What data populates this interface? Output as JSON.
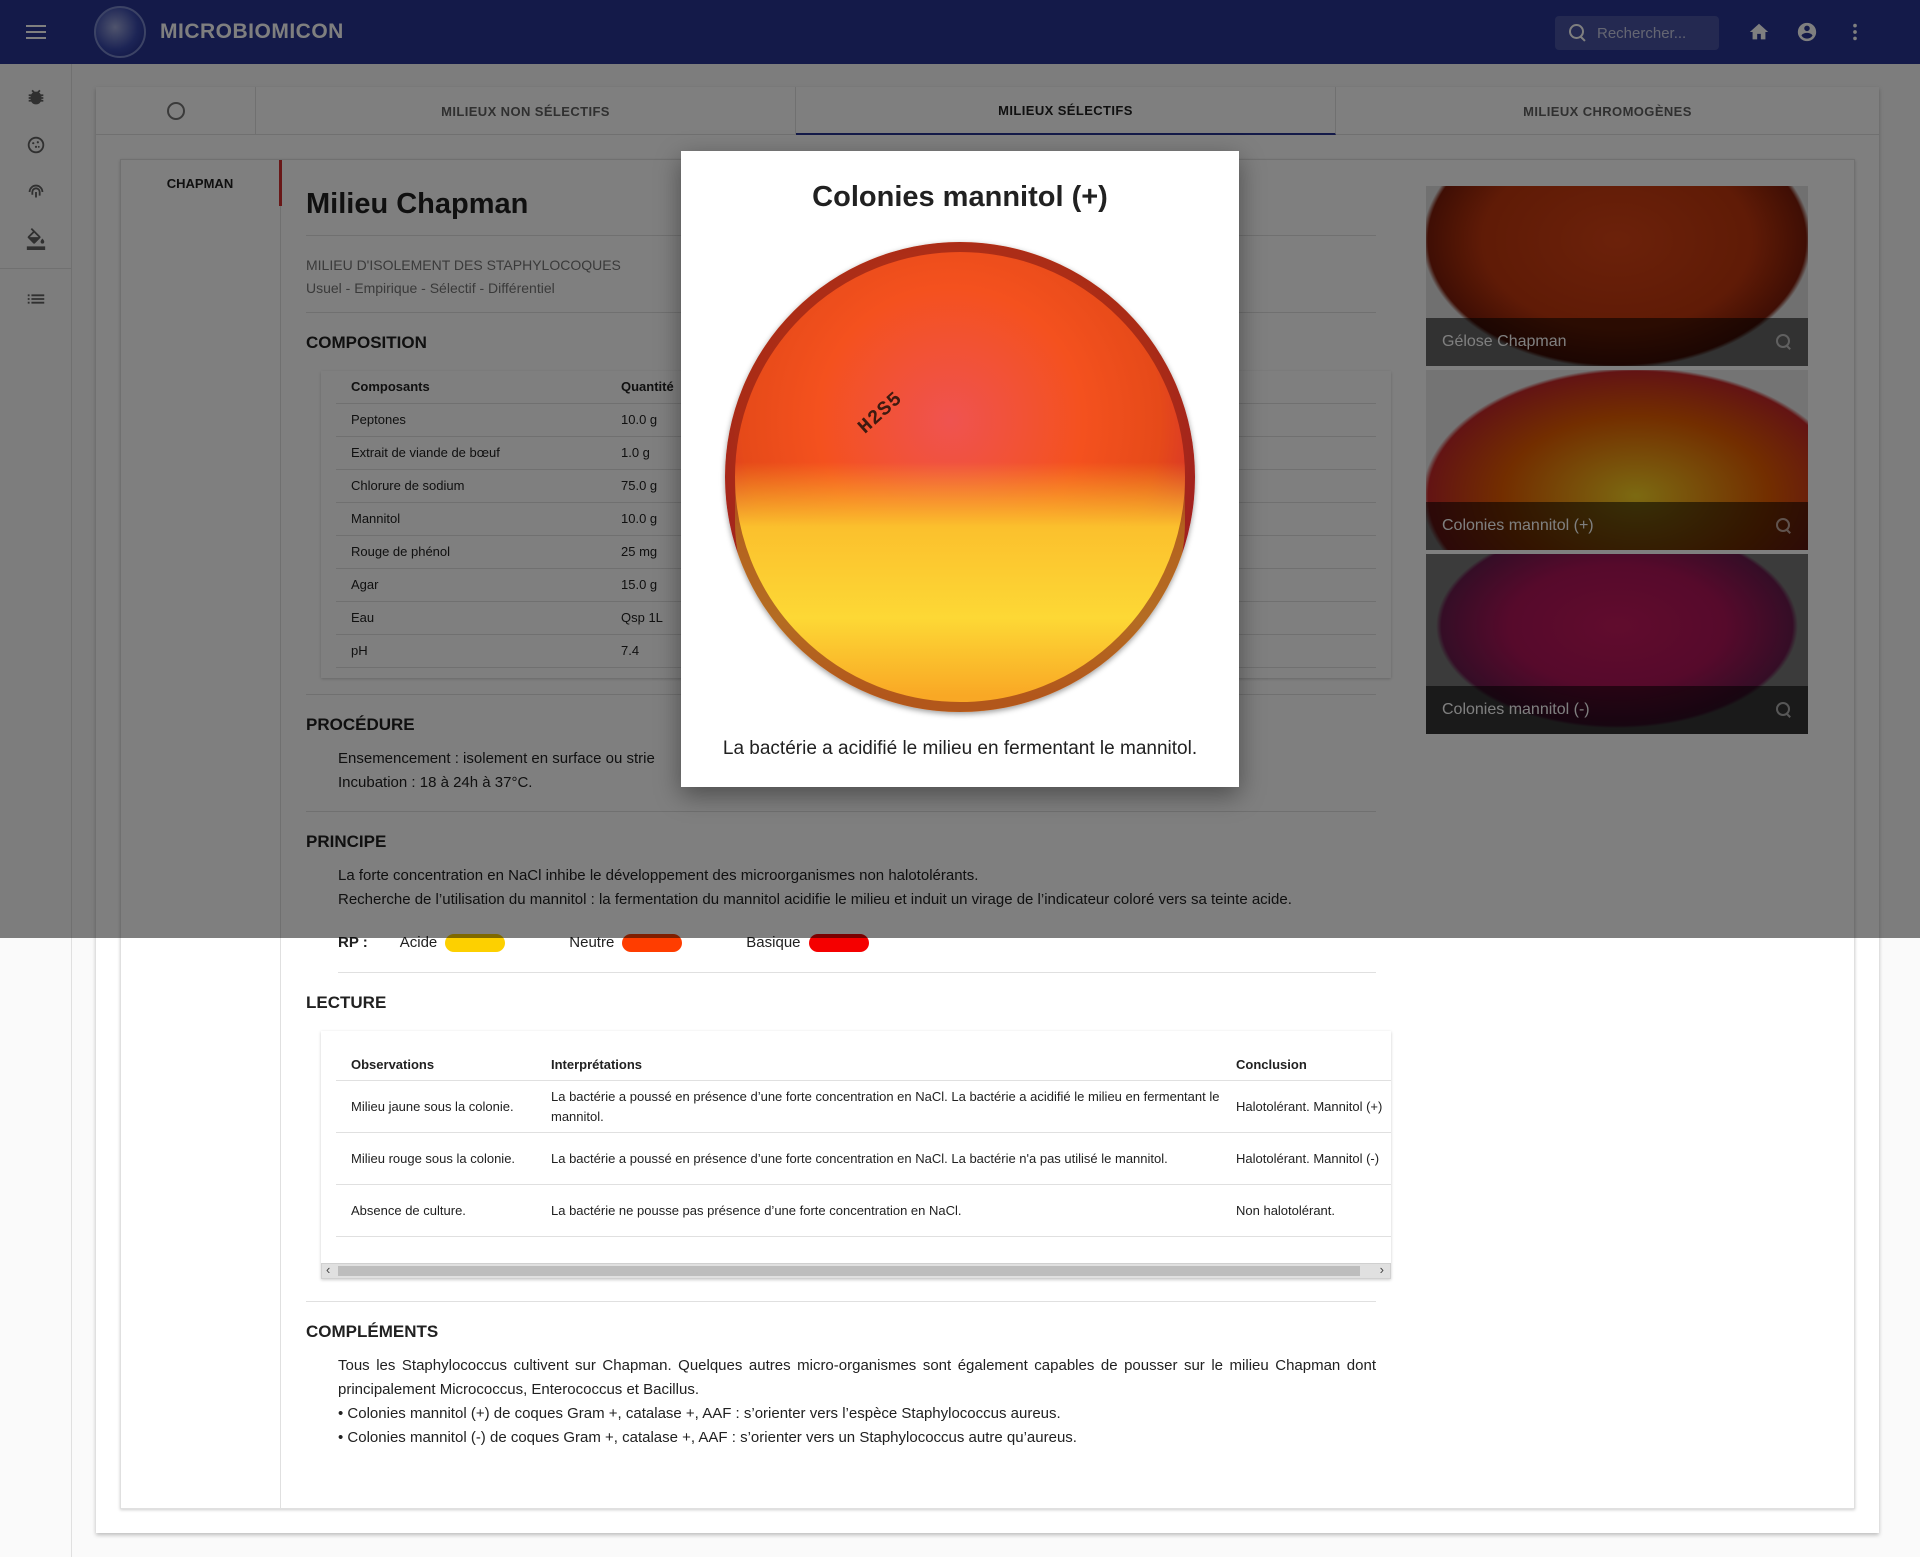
{
  "app": {
    "title": "MICROBIOMICON"
  },
  "search": {
    "placeholder": "Rechercher..."
  },
  "tabs": [
    {
      "label": "MILIEUX NON SÉLECTIFS"
    },
    {
      "label": "MILIEUX SÉLECTIFS"
    },
    {
      "label": "MILIEUX CHROMOGÈNES"
    }
  ],
  "side_nav": {
    "item": "CHAPMAN"
  },
  "page": {
    "title": "Milieu Chapman",
    "subtitle": "MILIEU D'ISOLEMENT DES STAPHYLOCOQUES",
    "tags": "Usuel - Empirique - Sélectif - Différentiel"
  },
  "composition": {
    "heading": "COMPOSITION",
    "col_component": "Composants",
    "col_quantity": "Quantité",
    "rows": [
      {
        "c": "Peptones",
        "q": "10.0 g"
      },
      {
        "c": "Extrait de viande de bœuf",
        "q": "1.0 g"
      },
      {
        "c": "Chlorure de sodium",
        "q": "75.0 g"
      },
      {
        "c": "Mannitol",
        "q": "10.0 g"
      },
      {
        "c": "Rouge de phénol",
        "q": "25 mg"
      },
      {
        "c": "Agar",
        "q": "15.0 g"
      },
      {
        "c": "Eau",
        "q": "Qsp 1L"
      },
      {
        "c": "pH",
        "q": "7.4"
      }
    ]
  },
  "procedure": {
    "heading": "PROCÉDURE",
    "line1": "Ensemencement : isolement en surface ou strie",
    "line2": "Incubation : 18 à 24h à 37°C."
  },
  "principe": {
    "heading": "PRINCIPE",
    "line1": "La forte concentration en NaCl inhibe le développement des microorganismes non halotolérants.",
    "line2": "Recherche de l’utilisation du mannitol : la fermentation du mannitol acidifie le milieu et induit un virage de l’indicateur coloré vers sa teinte acide."
  },
  "rp": {
    "label": "RP :",
    "acid": "Acide",
    "neutral": "Neutre",
    "basic": "Basique",
    "acid_color": "#fdd000",
    "neutral_color": "#ff3d00",
    "basic_color": "#f50000"
  },
  "lecture": {
    "heading": "LECTURE",
    "col_obs": "Observations",
    "col_interp": "Interprétations",
    "col_concl": "Conclusion",
    "rows": [
      {
        "obs": "Milieu jaune sous la colonie.",
        "interp": "La bactérie a poussé en présence d’une forte concentration en NaCl. La bactérie a acidifié le milieu en fermentant le mannitol.",
        "concl": "Halotolérant. Mannitol (+)"
      },
      {
        "obs": "Milieu rouge sous la colonie.",
        "interp": "La bactérie a poussé en présence d’une forte concentration en NaCl. La bactérie n'a pas utilisé le mannitol.",
        "concl": "Halotolérant. Mannitol (-)"
      },
      {
        "obs": "Absence de culture.",
        "interp": "La bactérie ne pousse pas présence d’une forte concentration en NaCl.",
        "concl": "Non halotolérant."
      }
    ]
  },
  "complements": {
    "heading": "COMPLÉMENTS",
    "line1": "Tous les Staphylococcus cultivent sur Chapman. Quelques autres micro-organismes sont également capables de pousser sur le milieu Chapman dont principalement Micrococcus, Enterococcus et Bacillus.",
    "line2": "• Colonies mannitol (+) de coques Gram +, catalase +, AAF : s’orienter vers l’espèce Staphylococcus aureus.",
    "line3": "• Colonies mannitol (-) de coques Gram +, catalase +, AAF : s’orienter vers un Staphylococcus autre qu’aureus."
  },
  "gallery": [
    {
      "caption": "Gélose Chapman"
    },
    {
      "caption": "Colonies mannitol (+)"
    },
    {
      "caption": "Colonies mannitol (-)"
    }
  ],
  "dialog": {
    "title": "Colonies mannitol (+)",
    "plate_label": "H2S5",
    "caption": "La bactérie a acidifié le milieu en fermentant le mannitol."
  }
}
